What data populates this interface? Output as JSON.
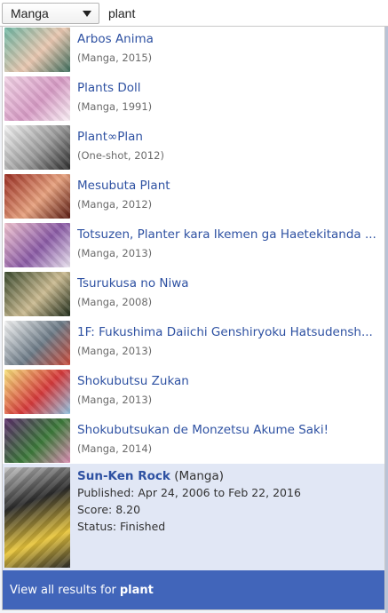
{
  "search": {
    "type_selected": "Manga",
    "query": "plant"
  },
  "results": [
    {
      "title": "Arbos Anima",
      "meta": "(Manga, 2015)",
      "thumb_colors": [
        "#6fb7a4",
        "#e9c7b0",
        "#3d6d5c"
      ]
    },
    {
      "title": "Plants Doll",
      "meta": "(Manga, 1991)",
      "thumb_colors": [
        "#f2d4e6",
        "#d79bc5",
        "#faf0f5"
      ]
    },
    {
      "title": "Plant∞Plan",
      "meta": "(One-shot, 2012)",
      "thumb_colors": [
        "#f3f3f3",
        "#9a9a9a",
        "#2b2b2b"
      ]
    },
    {
      "title": "Mesubuta Plant",
      "meta": "(Manga, 2012)",
      "thumb_colors": [
        "#9a2d22",
        "#e6a07d",
        "#5a1b12"
      ]
    },
    {
      "title": "Totsuzen, Planter kara Ikemen ga Haetekitanda ...",
      "meta": "(Manga, 2013)",
      "thumb_colors": [
        "#f0c3cf",
        "#8a5aa5",
        "#e9e2ef"
      ]
    },
    {
      "title": "Tsurukusa no Niwa",
      "meta": "(Manga, 2008)",
      "thumb_colors": [
        "#3a4a2e",
        "#c9b98f",
        "#1d2a18"
      ]
    },
    {
      "title": "1F: Fukushima Daiichi Genshiryoku Hatsudensh...",
      "meta": "(Manga, 2013)",
      "thumb_colors": [
        "#f4f4f4",
        "#6c7a86",
        "#c84a3a"
      ]
    },
    {
      "title": "Shokubutsu Zukan",
      "meta": "(Manga, 2013)",
      "thumb_colors": [
        "#f6e27a",
        "#d6393b",
        "#8fc2e0"
      ]
    },
    {
      "title": "Shokubutsukan de Monzetsu Akume Saki!",
      "meta": "(Manga, 2014)",
      "thumb_colors": [
        "#5b2d6a",
        "#3c7a3a",
        "#d98ab0"
      ]
    }
  ],
  "featured": {
    "title": "Sun-Ken Rock",
    "type": "(Manga)",
    "published": "Published: Apr 24, 2006 to Feb 22, 2016",
    "score": "Score: 8.20",
    "status": "Status: Finished",
    "thumb_colors": [
      "#e9c63c",
      "#2c2c2c",
      "#c7c7c7"
    ]
  },
  "view_all": {
    "label": "View all results for",
    "query": "plant"
  },
  "colors": {
    "link": "#2e51a2",
    "featured_bg": "#e1e7f5",
    "footer_bg": "#4165ba"
  }
}
